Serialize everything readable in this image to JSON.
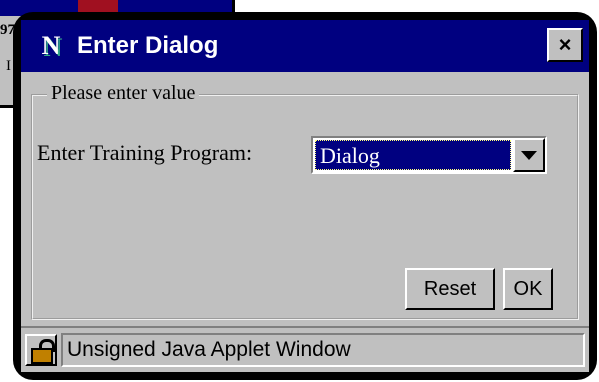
{
  "background_window": {
    "fragment_top": "97",
    "fragment_bottom": "I"
  },
  "dialog": {
    "app_icon": "N",
    "title": "Enter Dialog",
    "close_glyph": "×"
  },
  "group": {
    "legend": "Please enter value",
    "field_label": "Enter Training Program:",
    "select_value": "Dialog"
  },
  "buttons": {
    "reset_label": "Reset",
    "ok_label": "OK"
  },
  "status": {
    "text": "Unsigned Java Applet Window"
  }
}
